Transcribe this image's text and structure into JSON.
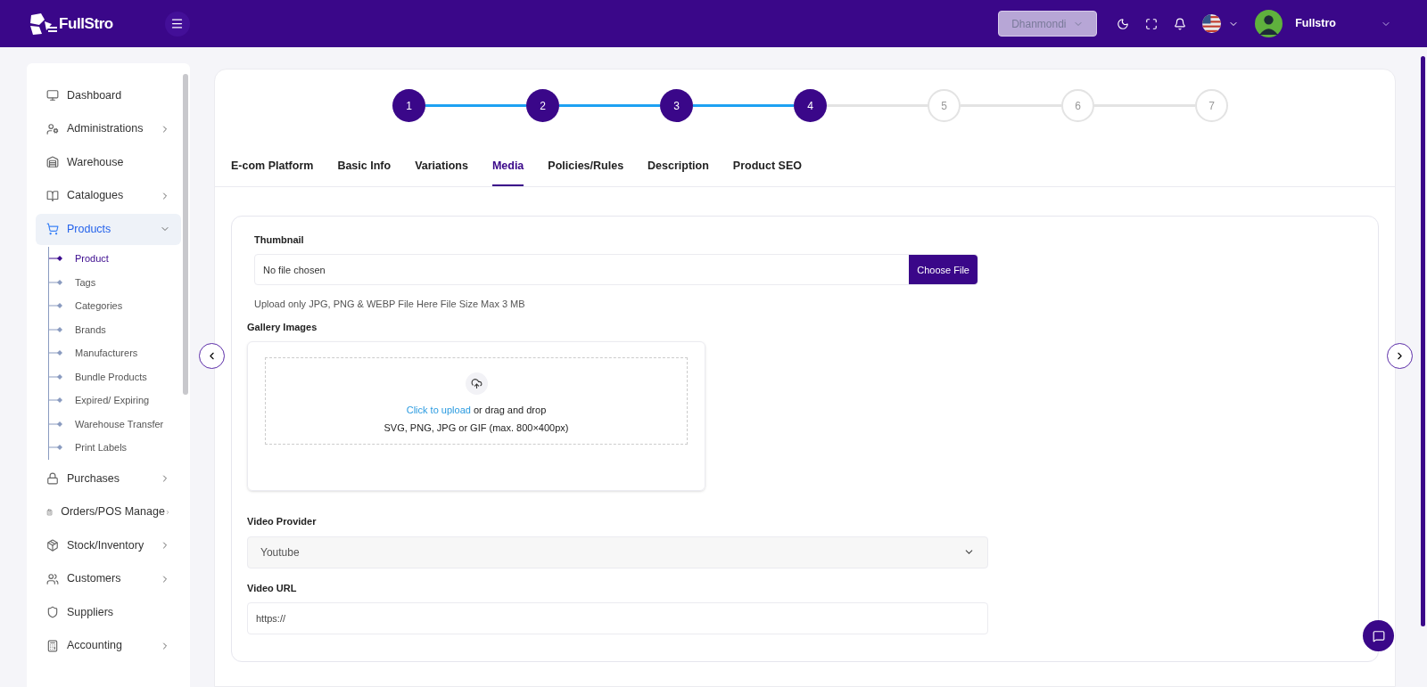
{
  "header": {
    "logo": "FullStro",
    "branch": "Dhanmondi",
    "user": "Fullstro"
  },
  "sidebar": {
    "items": [
      {
        "label": "Dashboard",
        "submenu": false,
        "selected": false
      },
      {
        "label": "Administrations",
        "submenu": true,
        "selected": false
      },
      {
        "label": "Warehouse",
        "submenu": false,
        "selected": false
      },
      {
        "label": "Catalogues",
        "submenu": true,
        "selected": false
      },
      {
        "label": "Products",
        "submenu": true,
        "selected": true,
        "expanded": true,
        "children": [
          {
            "label": "Product",
            "selected": true
          },
          {
            "label": "Tags",
            "selected": false
          },
          {
            "label": "Categories",
            "selected": false
          },
          {
            "label": "Brands",
            "selected": false
          },
          {
            "label": "Manufacturers",
            "selected": false
          },
          {
            "label": "Bundle Products",
            "selected": false
          },
          {
            "label": "Expired/ Expiring",
            "selected": false
          },
          {
            "label": "Warehouse Transfer",
            "selected": false
          },
          {
            "label": "Print Labels",
            "selected": false
          }
        ]
      },
      {
        "label": "Purchases",
        "submenu": true,
        "selected": false
      },
      {
        "label": "Orders/POS Manage",
        "submenu": true,
        "selected": false
      },
      {
        "label": "Stock/Inventory",
        "submenu": true,
        "selected": false
      },
      {
        "label": "Customers",
        "submenu": true,
        "selected": false
      },
      {
        "label": "Suppliers",
        "submenu": false,
        "selected": false
      },
      {
        "label": "Accounting",
        "submenu": true,
        "selected": false
      }
    ]
  },
  "steps": [
    {
      "label": "1",
      "completed": true
    },
    {
      "label": "2",
      "completed": true
    },
    {
      "label": "3",
      "completed": true
    },
    {
      "label": "4",
      "completed": true
    },
    {
      "label": "5",
      "completed": false
    },
    {
      "label": "6",
      "completed": false
    },
    {
      "label": "7",
      "completed": false
    }
  ],
  "tabs": [
    {
      "label": "E-com Platform",
      "selected": false
    },
    {
      "label": "Basic Info",
      "selected": false
    },
    {
      "label": "Variations",
      "selected": false
    },
    {
      "label": "Media",
      "selected": true
    },
    {
      "label": "Policies/Rules",
      "selected": false
    },
    {
      "label": "Description",
      "selected": false
    },
    {
      "label": "Product SEO",
      "selected": false
    }
  ],
  "form": {
    "thumbnail": {
      "label": "Thumbnail",
      "file_status": "No file chosen",
      "button": "Choose File",
      "hint": "Upload only JPG, PNG & WEBP File Here File Size Max 3 MB"
    },
    "gallery": {
      "label": "Gallery Images",
      "link": "Click to upload",
      "text": "or drag and drop",
      "formats": "SVG, PNG, JPG or GIF (max. 800×400px)"
    },
    "video_provider": {
      "label": "Video Provider",
      "value": "Youtube"
    },
    "video_url": {
      "label": "Video URL",
      "value": "https://"
    }
  }
}
